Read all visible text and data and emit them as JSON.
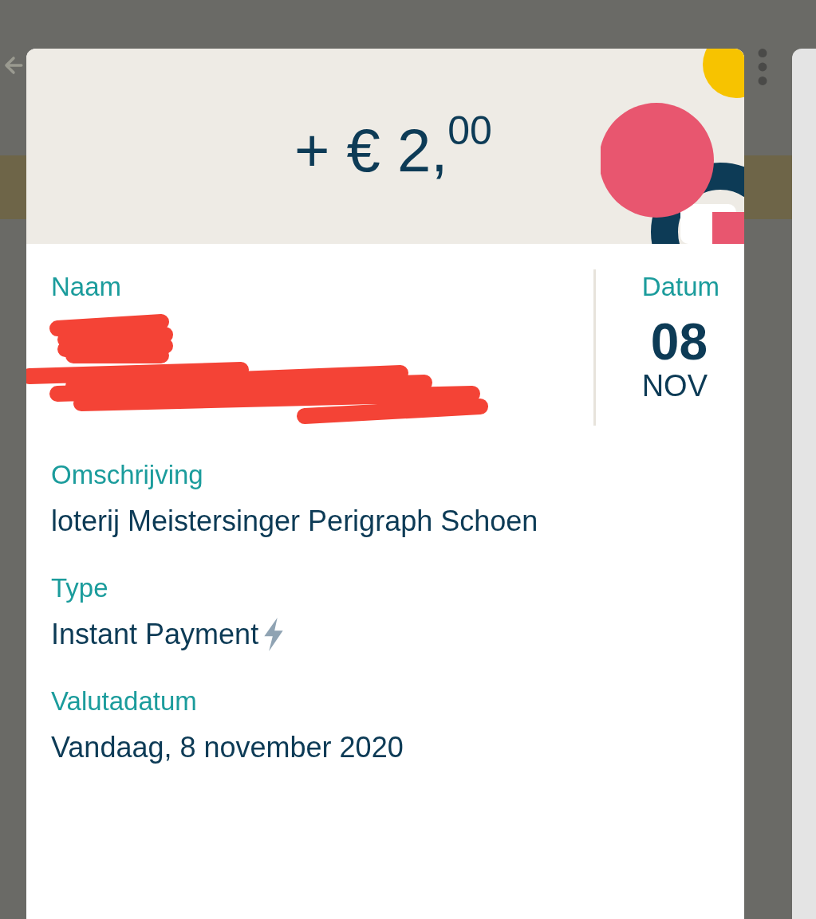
{
  "detail": {
    "amount": "+ € 2,$^{00}$",
    "name_label": "Naam",
    "date_label": "Datum",
    "day": "08",
    "month": "NOV",
    "fields": [
      {
        "label": "Omschrijving",
        "value": "loterij Meistersinger Perigraph Schoen",
        "kind": "text"
      },
      {
        "label": "Type",
        "value": "Instant Payment",
        "kind": "instant"
      },
      {
        "label": "Valutadatum",
        "value": "Vandaag, 8 november 2020",
        "kind": "text"
      }
    ]
  }
}
